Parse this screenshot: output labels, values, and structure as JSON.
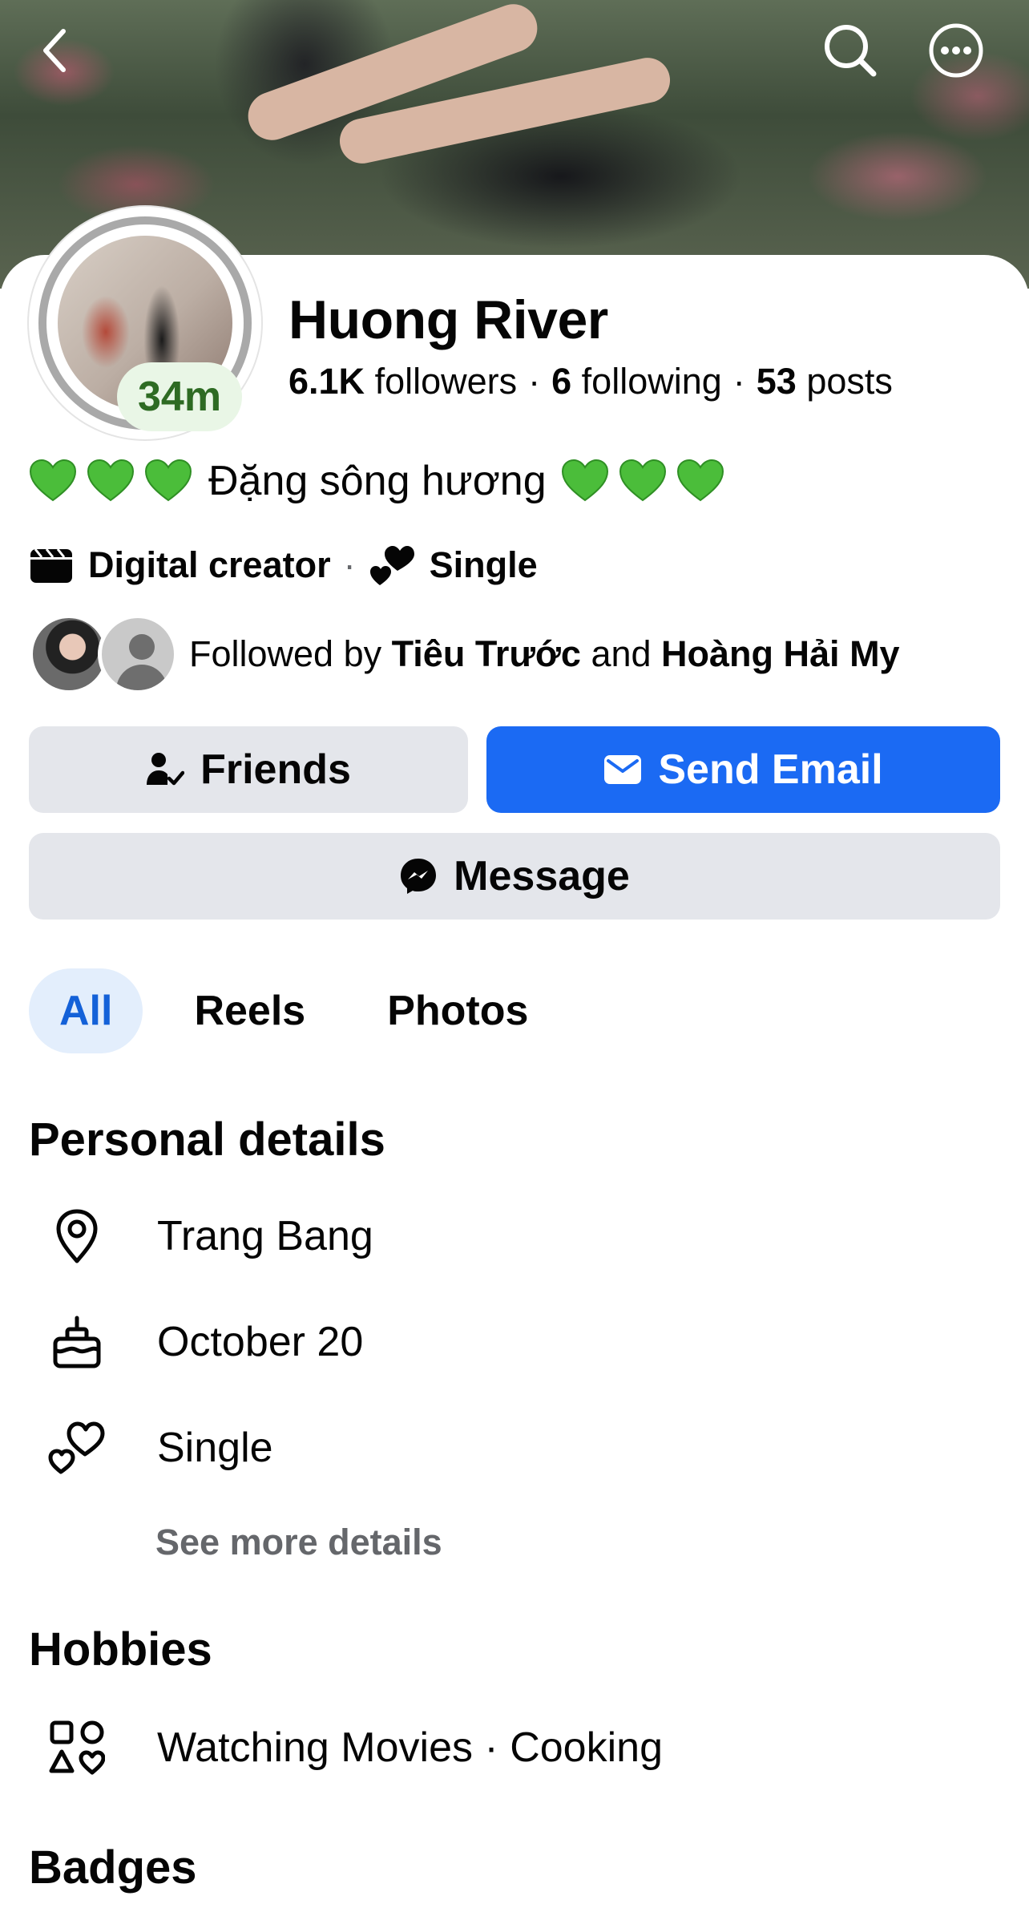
{
  "header": {
    "back_icon": "chevron-left-icon",
    "search_icon": "search-icon",
    "more_icon": "more-horizontal-icon"
  },
  "profile": {
    "name": "Huong River",
    "story_time": "34m",
    "followers_count": "6.1K",
    "followers_label": " followers",
    "following_count": "6",
    "following_label": " following",
    "posts_count": "53",
    "posts_label": " posts",
    "separator": "·",
    "bio": "Đặng sông hương",
    "heart_color": "#4bbd3a",
    "category": "Digital creator",
    "relationship": "Single"
  },
  "followed_by": {
    "prefix": "Followed by ",
    "name1": "Tiêu Trước",
    "conjunction": " and ",
    "name2": "Hoàng Hải My"
  },
  "actions": {
    "friends_label": "Friends",
    "email_label": "Send Email",
    "message_label": "Message",
    "accent_color": "#1b6af3"
  },
  "tabs": [
    {
      "label": "All",
      "active": true
    },
    {
      "label": "Reels",
      "active": false
    },
    {
      "label": "Photos",
      "active": false
    }
  ],
  "personal_details": {
    "title": "Personal details",
    "items": [
      {
        "icon": "location-pin-icon",
        "text": "Trang Bang"
      },
      {
        "icon": "birthday-cake-icon",
        "text": "October 20"
      },
      {
        "icon": "hearts-icon",
        "text": "Single"
      }
    ],
    "see_more": "See more details"
  },
  "hobbies": {
    "title": "Hobbies",
    "icon": "shapes-icon",
    "text": "Watching Movies · Cooking"
  },
  "badges": {
    "title": "Badges"
  }
}
